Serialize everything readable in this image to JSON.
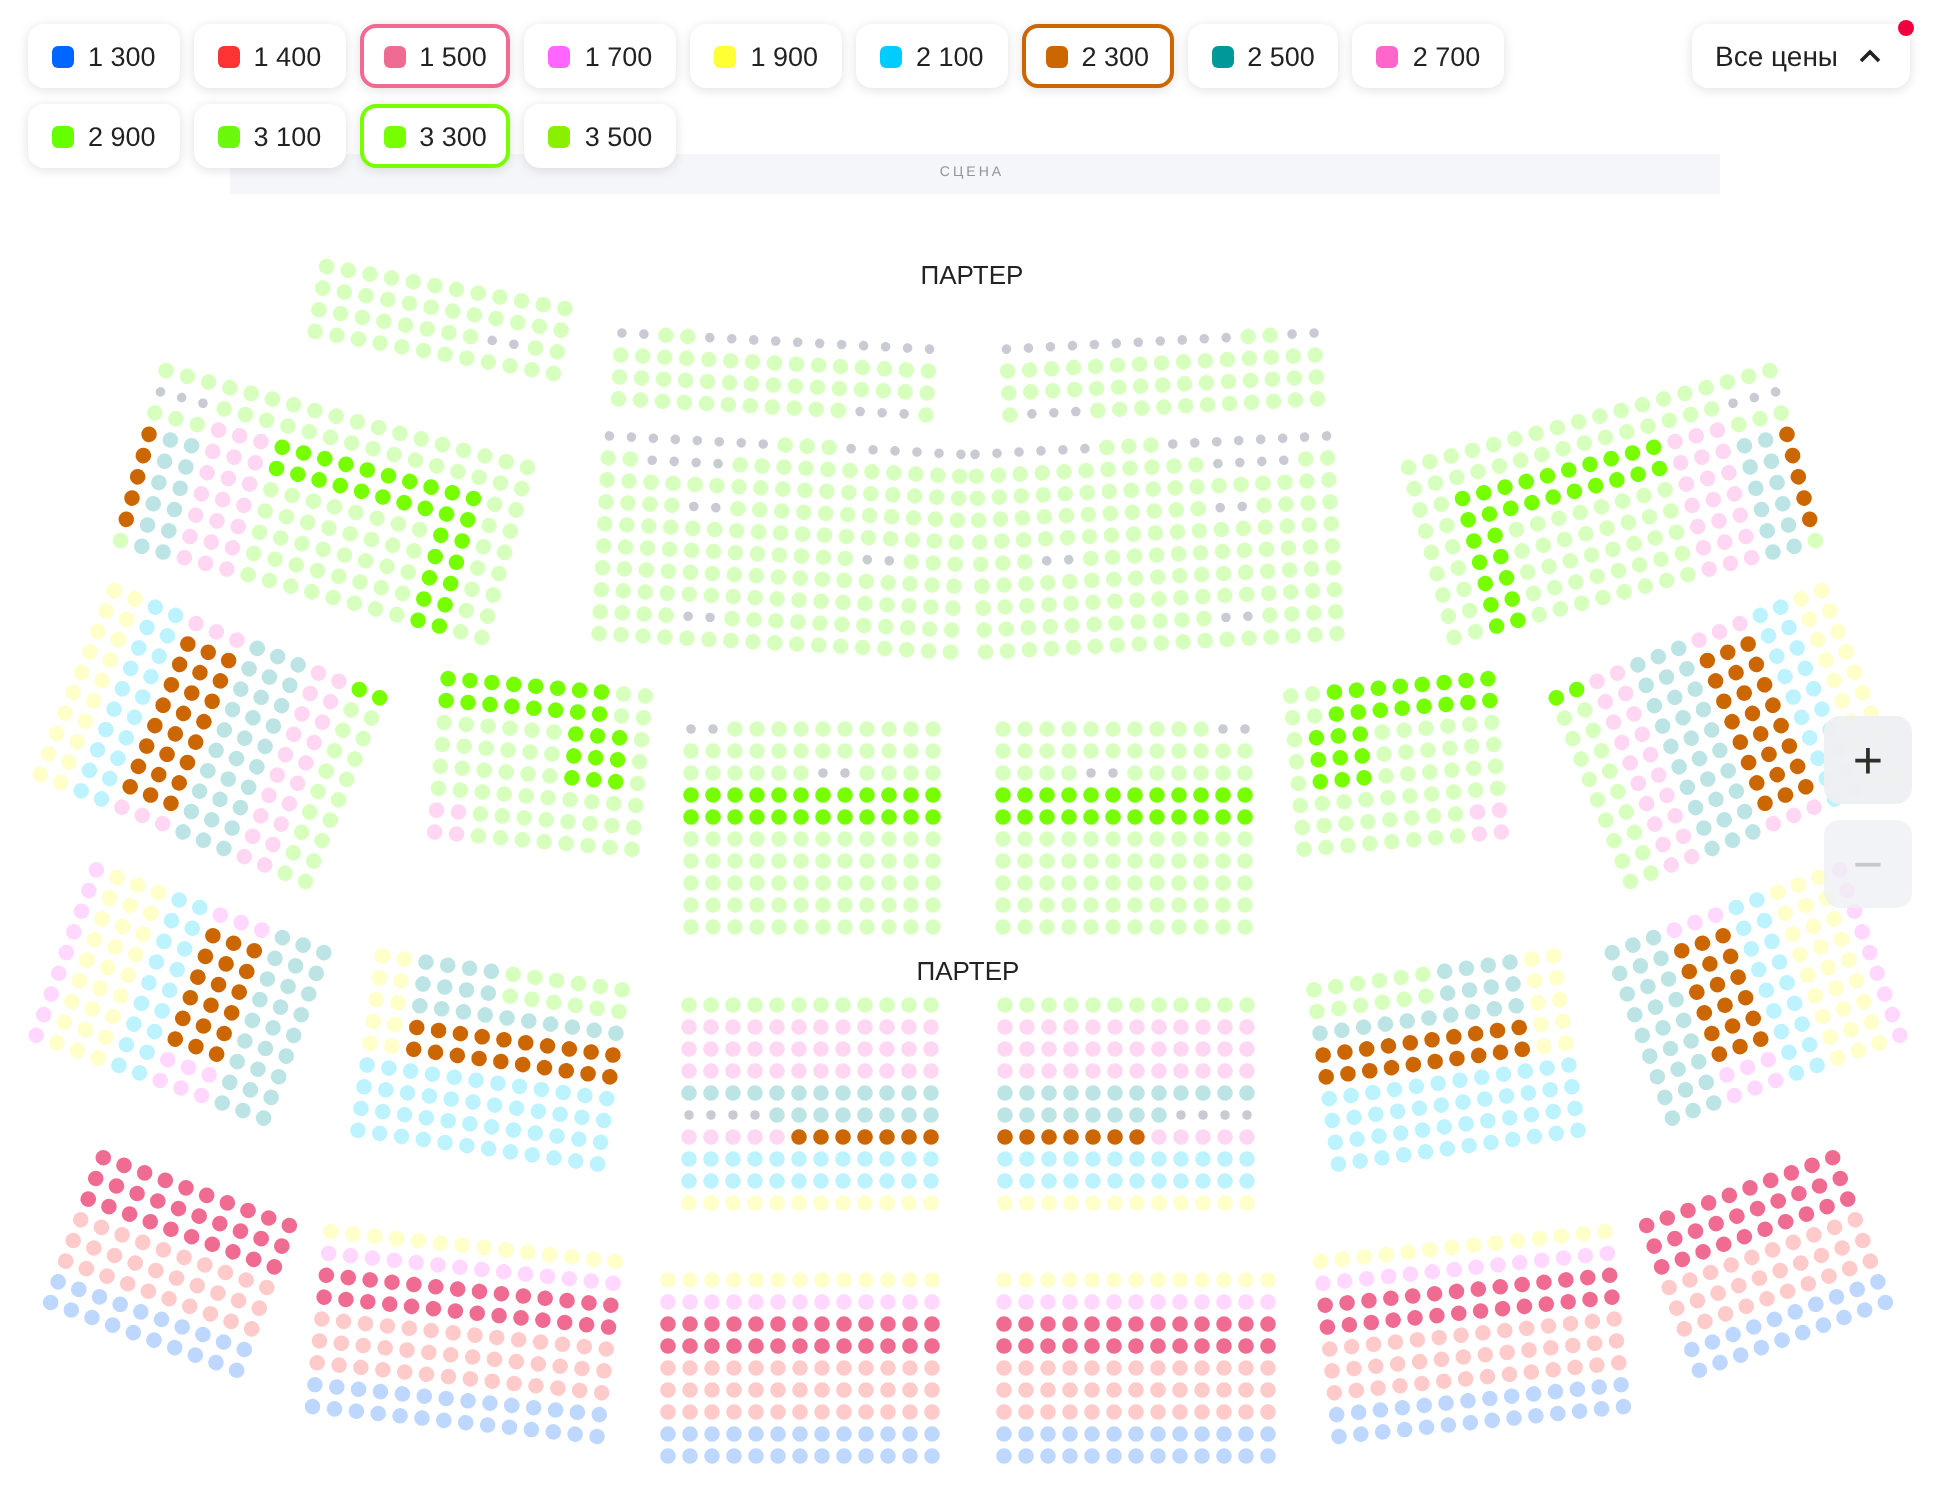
{
  "price_filters": [
    {
      "label": "1 300",
      "color": "#0066ff",
      "selected": false
    },
    {
      "label": "1 400",
      "color": "#ff3333",
      "selected": false
    },
    {
      "label": "1 500",
      "color": "#f06b91",
      "selected": true
    },
    {
      "label": "1 700",
      "color": "#ff66ff",
      "selected": false
    },
    {
      "label": "1 900",
      "color": "#ffff33",
      "selected": false
    },
    {
      "label": "2 100",
      "color": "#00ccff",
      "selected": false
    },
    {
      "label": "2 300",
      "color": "#cc6600",
      "selected": true
    },
    {
      "label": "2 500",
      "color": "#009999",
      "selected": false
    },
    {
      "label": "2 700",
      "color": "#ff66cc",
      "selected": false
    },
    {
      "label": "2 900",
      "color": "#66ff00",
      "selected": false
    },
    {
      "label": "3 100",
      "color": "#6cf80a",
      "selected": false
    },
    {
      "label": "3 300",
      "color": "#77ff00",
      "selected": true
    },
    {
      "label": "3 500",
      "color": "#88f000",
      "selected": false
    }
  ],
  "all_prices_button": {
    "label": "Все цены",
    "expanded": true,
    "notification": true
  },
  "stage": {
    "label": "СЦЕНА"
  },
  "section_labels": [
    "ПАРТЕР",
    "ПАРТЕР"
  ],
  "zoom": {
    "zoom_in": "+",
    "zoom_out": "−",
    "zoom_out_disabled": true
  }
}
